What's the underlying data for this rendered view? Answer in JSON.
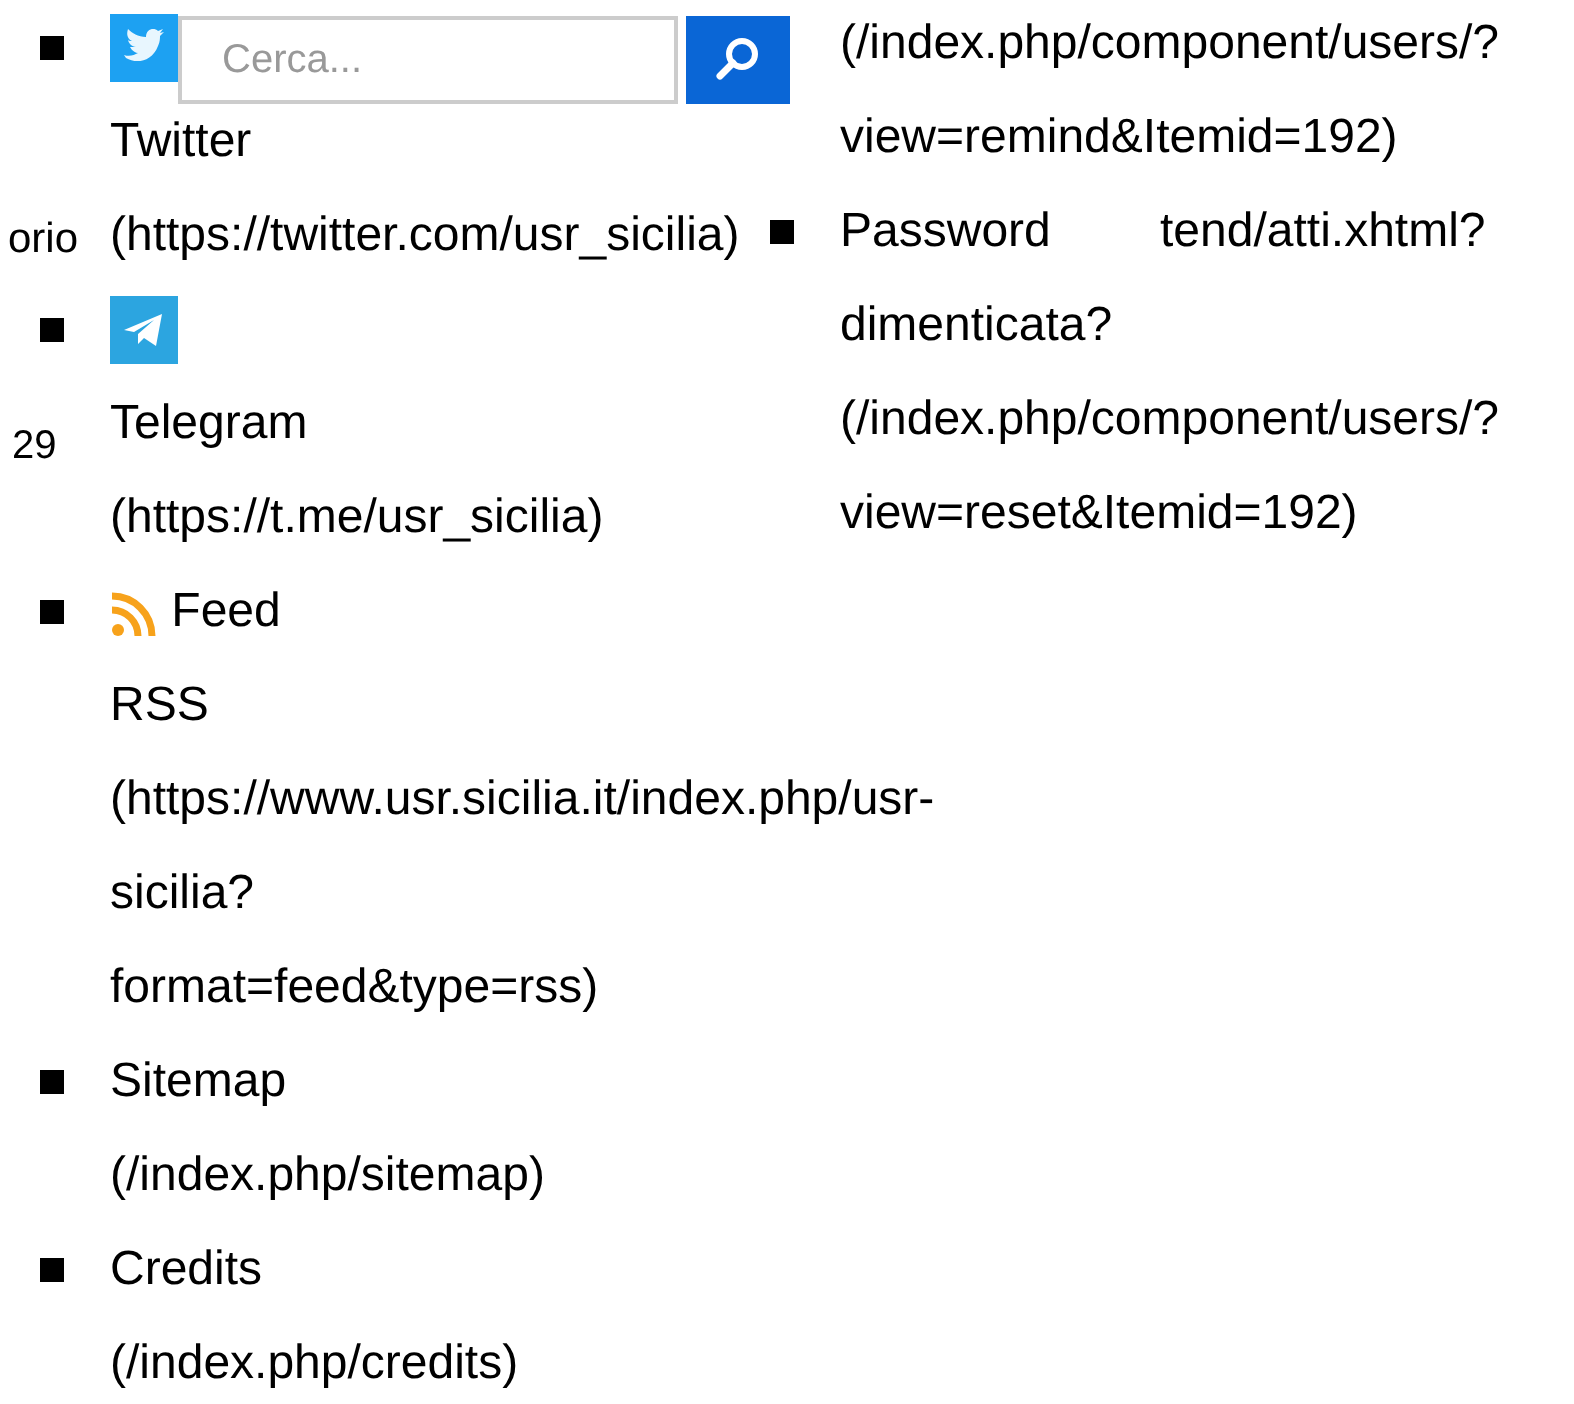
{
  "search": {
    "placeholder": "Cerca..."
  },
  "social_list": [
    {
      "kind": "twitter",
      "lines": [
        "Twitter",
        "(https://twitter.com/usr_sicilia)"
      ]
    },
    {
      "kind": "telegram",
      "lines": [
        "Telegram",
        "(https://t.me/usr_sicilia)"
      ]
    },
    {
      "kind": "rss",
      "lines": [
        "Feed",
        "RSS",
        "(https://www.usr.sicilia.it/index.php/usr-",
        "sicilia?",
        "format=feed&type=rss)"
      ]
    },
    {
      "kind": "plain",
      "lines": [
        "Sitemap",
        "(/index.php/sitemap)"
      ]
    },
    {
      "kind": "plain",
      "lines": [
        "Credits",
        "(/index.php/credits)"
      ]
    }
  ],
  "user_links": [
    {
      "bullet_visible": false,
      "lines": [
        "(/index.php/component/users/?",
        "view=remind&Itemid=192)"
      ]
    },
    {
      "bullet_visible": true,
      "lines": [
        "Password",
        "dimenticata?",
        "(/index.php/component/users/?",
        "view=reset&Itemid=192)"
      ]
    }
  ],
  "fragments": [
    "orio",
    "29",
    "tend/atti.xhtml?"
  ]
}
